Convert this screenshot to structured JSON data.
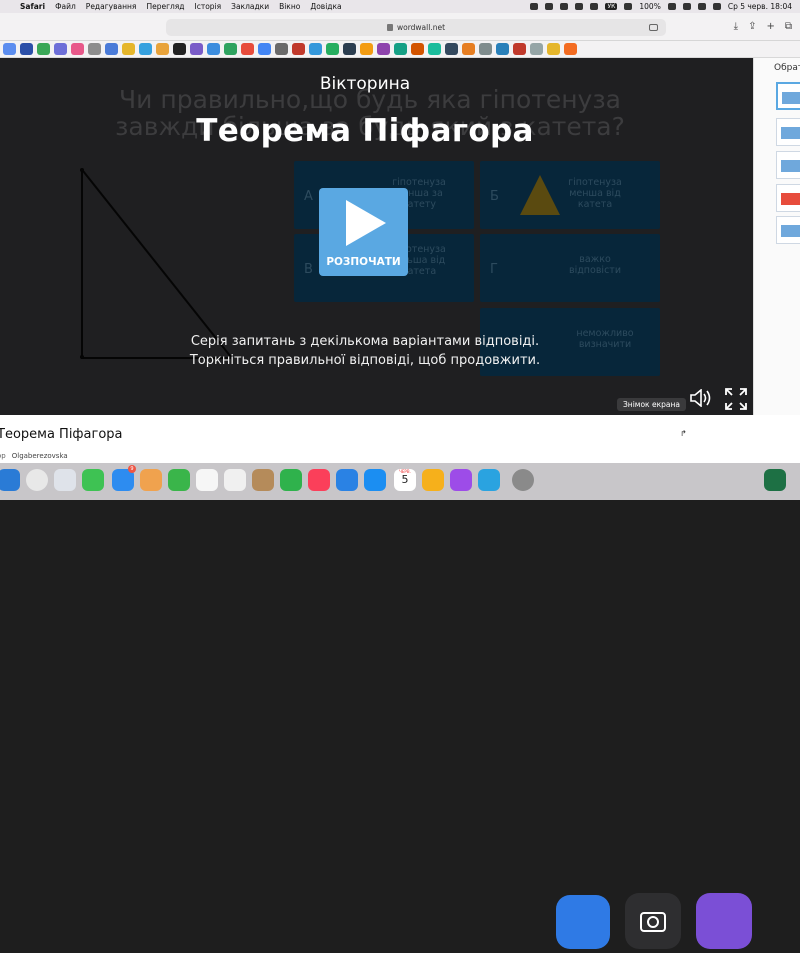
{
  "menubar": {
    "items": [
      "Safari",
      "Файл",
      "Редагування",
      "Перегляд",
      "Історія",
      "Закладки",
      "Вікно",
      "Довідка"
    ],
    "keyboard": "УК",
    "battery": "100%",
    "datetime": "Ср 5 черв.  18:04"
  },
  "browser": {
    "url": "wordwall.net"
  },
  "activity": {
    "background_question": "Чи правильно,що будь яка гіпотенуза завжди більша за будь-який з катета?",
    "background_options": [
      {
        "letter": "А",
        "text": "гіпотенуза менша за катету"
      },
      {
        "letter": "Б",
        "text": "гіпотенуза менша від катета"
      },
      {
        "letter": "В",
        "text": "гіпотенуза більша від катета"
      },
      {
        "letter": "Г",
        "text": "важко відповісти"
      },
      {
        "letter": "",
        "text": "неможливо визначити"
      }
    ],
    "subtitle": "Вікторина",
    "title": "Теорема Піфагора",
    "start_label": "РОЗПОЧАТИ",
    "description_line1": "Серія запитань з декількома варіантами відповіді.",
    "description_line2": "Торкніться правильної відповіді, щоб продовжити.",
    "tooltip": "Знімок екрана"
  },
  "sidebar": {
    "header": "Обрат"
  },
  "page": {
    "title": "Теорема Піфагора",
    "author_prefix": "op",
    "author": "Olgaberezovska"
  },
  "dock": {
    "mail_badge": "9",
    "calendar_month": "ЧЕРВ.",
    "calendar_day": "5"
  },
  "colors": {
    "start_button": "#5aa8e2",
    "stage_background": "#1f1f21",
    "option_tile": "#07263a"
  }
}
